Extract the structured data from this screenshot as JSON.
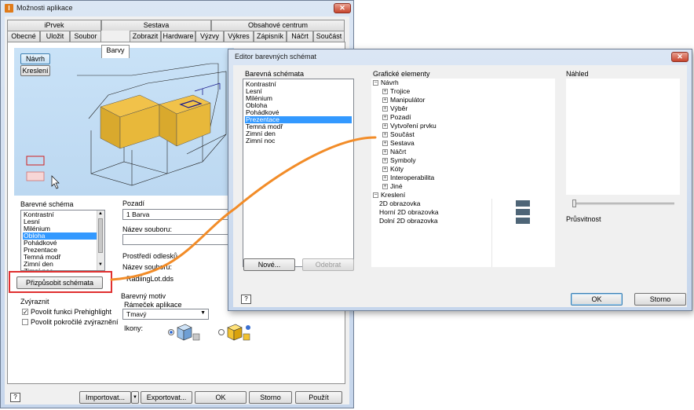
{
  "main": {
    "title": "Možnosti aplikace",
    "tabs_row1": [
      "iPrvek",
      "Sestava",
      "Obsahové centrum"
    ],
    "tabs_row2": [
      "Obecné",
      "Uložit",
      "Soubor",
      "Barvy",
      "Zobrazit",
      "Hardware",
      "Výzvy",
      "Výkres",
      "Zápisník",
      "Náčrt",
      "Součást"
    ],
    "preview_buttons": {
      "design": "Návrh",
      "drawing": "Kreslení"
    },
    "color_scheme_label": "Barevné schéma",
    "color_schemes": [
      "Kontrastní",
      "Lesní",
      "Milénium",
      "Obloha",
      "Pohádkové",
      "Prezentace",
      "Temná modř",
      "Zimní den",
      "Zimní noc"
    ],
    "selected_scheme": "Obloha",
    "customize_button": "Přizpůsobit schémata",
    "background_label": "Pozadí",
    "background_value": "1 Barva",
    "file_name_label": "Název souboru:",
    "reflection_label": "Prostředí odlesků",
    "reflection_file_label": "Název souboru:",
    "reflection_file": "RadiingLot.dds",
    "highlight_label": "Zvýraznit",
    "highlight_options": [
      "Povolit funkci Prehighlight",
      "Povolit pokročilé zvýraznění"
    ],
    "highlight_checked": [
      true,
      false
    ],
    "color_theme_label": "Barevný motiv",
    "app_frame_label": "Rámeček aplikace",
    "app_frame_value": "Tmavý",
    "icons_label": "Ikony:",
    "footer": {
      "import": "Importovat...",
      "export": "Exportovat...",
      "ok": "OK",
      "cancel": "Storno",
      "apply": "Použít"
    }
  },
  "editor": {
    "title": "Editor barevných schémat",
    "schemes_label": "Barevná schémata",
    "schemes": [
      "Kontrastní",
      "Lesní",
      "Milénium",
      "Obloha",
      "Pohádkové",
      "Prezentace",
      "Temná modř",
      "Zimní den",
      "Zimní noc"
    ],
    "selected_scheme": "Prezentace",
    "new_button": "Nové...",
    "remove_button": "Odebrat",
    "elements_label": "Grafické elementy",
    "design_node": "Návrh",
    "design_children": [
      "Trojice",
      "Manipulátor",
      "Výběr",
      "Pozadí",
      "Vytvoření prvku",
      "Součást",
      "Sestava",
      "Náčrt",
      "Symboly",
      "Kóty",
      "Interoperabilita",
      "Jiné"
    ],
    "drawing_node": "Kreslení",
    "drawing_children": [
      "2D obrazovka",
      "Horní 2D obrazovka",
      "Dolní 2D obrazovka"
    ],
    "swatch_color": "#4e6577",
    "preview_label": "Náhled",
    "transparency_label": "Průsvitnost",
    "ok": "OK",
    "cancel": "Storno"
  },
  "colors": {
    "accent_curve": "#f28c28",
    "highlight_box": "#e03030",
    "selection": "#3399ff",
    "viewport_bg": "#c5dff5",
    "block_yellow": "#e8b83a"
  }
}
